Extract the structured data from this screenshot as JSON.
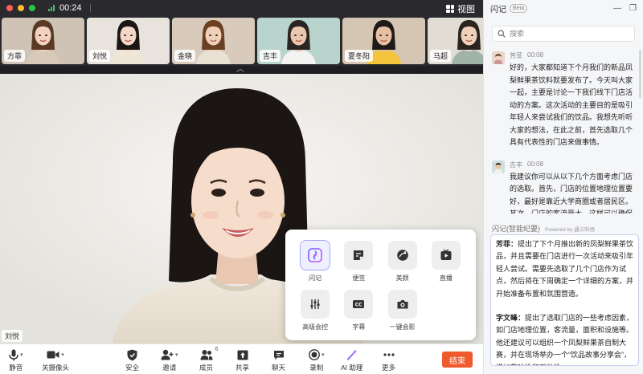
{
  "window": {
    "timer": "00:24",
    "view_label": "视图",
    "traffic_lights": [
      "#fe5f57",
      "#febc2e",
      "#28c840"
    ]
  },
  "participants": [
    {
      "name": "方菲",
      "selected": false,
      "bg": "#cfc3b5",
      "hair": "#5a3a24",
      "shirt": "#d9c9b8",
      "skin": "#f1d2bf"
    },
    {
      "name": "刘悦",
      "selected": true,
      "bg": "#e8e4dd",
      "hair": "#1b1614",
      "shirt": "#efe6d8",
      "skin": "#f4d8c6"
    },
    {
      "name": "金晓",
      "selected": false,
      "bg": "#d8cbbb",
      "hair": "#6a3f22",
      "shirt": "#e9e1d4",
      "skin": "#efd0b8"
    },
    {
      "name": "吉丰",
      "selected": false,
      "bg": "#b9d3cd",
      "hair": "#2a2522",
      "shirt": "#f3f3f2",
      "skin": "#e9c7ac"
    },
    {
      "name": "夏冬阳",
      "selected": false,
      "bg": "#d5c6b4",
      "hair": "#1f1a17",
      "shirt": "#f3c33c",
      "skin": "#e6c0a2"
    },
    {
      "name": "马超",
      "selected": false,
      "bg": "#e2ddd4",
      "hair": "#2a2421",
      "shirt": "#9fb4a6",
      "skin": "#efd0b8"
    }
  ],
  "main_speaker": {
    "name": "刘悦"
  },
  "apps": [
    {
      "label": "闪记",
      "icon": "flash-notes-icon",
      "highlight": true
    },
    {
      "label": "便签",
      "icon": "sticky-note-icon",
      "highlight": false
    },
    {
      "label": "美颜",
      "icon": "beauty-icon",
      "highlight": false
    },
    {
      "label": "直播",
      "icon": "live-icon",
      "highlight": false
    },
    {
      "label": "高级会控",
      "icon": "advanced-control-icon",
      "highlight": false
    },
    {
      "label": "字幕",
      "icon": "subtitle-icon",
      "highlight": false
    },
    {
      "label": "一键会影",
      "icon": "camera-icon",
      "highlight": false
    }
  ],
  "toolbar": {
    "mute": "静音",
    "camera_off": "关摄像头",
    "security": "安全",
    "invite": "邀请",
    "members": "成员",
    "members_count": "6",
    "share": "共享",
    "chat": "聊天",
    "record": "录制",
    "ai": "AI 助理",
    "more": "更多",
    "end": "结束",
    "end_color": "#f0592b"
  },
  "panel": {
    "title": "闪记",
    "beta": "Beta",
    "search_placeholder": "搜索",
    "messages": [
      {
        "speaker": "芳菲",
        "time": "00:08",
        "text": "好的，大家都知道下个月我们的新品凤梨鲜果茶饮料就要发布了。今天叫大家一起，主要是讨论一下我们线下门店活动的方案。这次活动的主要目的是吸引年轻人来尝试我们的饮品。我想先听听大家的想法，在此之前，首先选取几个具有代表性的门店来做事情。"
      },
      {
        "speaker": "吉丰",
        "time": "00:08",
        "text": "我建议你可以从以下几个方面考虑门店的选取。首先，门店的位置地理位置要好，最好是靠近大学商圈或者居民区。其次，门店的客流量大，这样可以确保活动的效果。最后我们还要考虑门店的"
      }
    ],
    "summary_title": "闪记(智能纪要)",
    "powered": "Powered by 通义听悟",
    "summary": [
      {
        "name": "芳菲：",
        "text": "提出了下个月推出新的凤梨鲜果茶饮品，并且需要在门店进行一次活动来吸引年轻人尝试。需要先选取了几个门店作为试点，然后将在下周确定一个详细的方案，并开始准备布置和氛围营造。"
      },
      {
        "name": "字文峰：",
        "text": "提出了选取门店的一些考虑因素，如门店地理位置，客流量，面积和设施等。他还建议可以组织一个凤梨鲜果茶自制大赛，并在现场举办一个“饮品故事分享会”，增加趣味性和互动性。"
      }
    ]
  }
}
